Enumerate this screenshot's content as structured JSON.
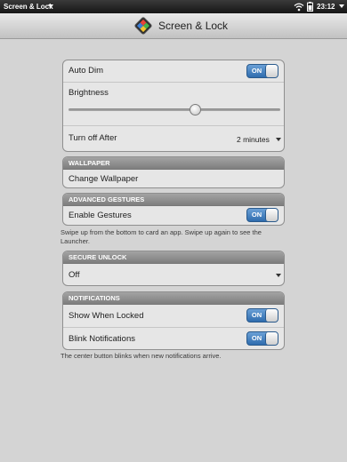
{
  "statusbar": {
    "app_title": "Screen & Lock",
    "time": "23:12",
    "icons": [
      "chevron-down-icon",
      "wifi-icon",
      "battery-icon",
      "chevron-down-icon"
    ]
  },
  "header": {
    "title": "Screen & Lock",
    "icon": "screen-lock-app-icon"
  },
  "display": {
    "auto_dim_label": "Auto Dim",
    "auto_dim_toggle": "ON",
    "brightness_label": "Brightness",
    "brightness_level": 0.6,
    "turn_off_label": "Turn off After",
    "turn_off_value": "2 minutes"
  },
  "wallpaper": {
    "header": "WALLPAPER",
    "change_label": "Change Wallpaper"
  },
  "gestures": {
    "header": "ADVANCED GESTURES",
    "enable_label": "Enable Gestures",
    "enable_toggle": "ON",
    "note": "Swipe up from the bottom to card an app. Swipe up again to see the Launcher."
  },
  "secure_unlock": {
    "header": "SECURE UNLOCK",
    "value": "Off"
  },
  "notifications": {
    "header": "NOTIFICATIONS",
    "show_locked_label": "Show When Locked",
    "show_locked_toggle": "ON",
    "blink_label": "Blink Notifications",
    "blink_toggle": "ON",
    "note": "The center button blinks when new notifications arrive."
  },
  "colors": {
    "toggle_on": "#2f6cae",
    "group_header": "#8e8e8e",
    "background": "#d4d4d4"
  }
}
